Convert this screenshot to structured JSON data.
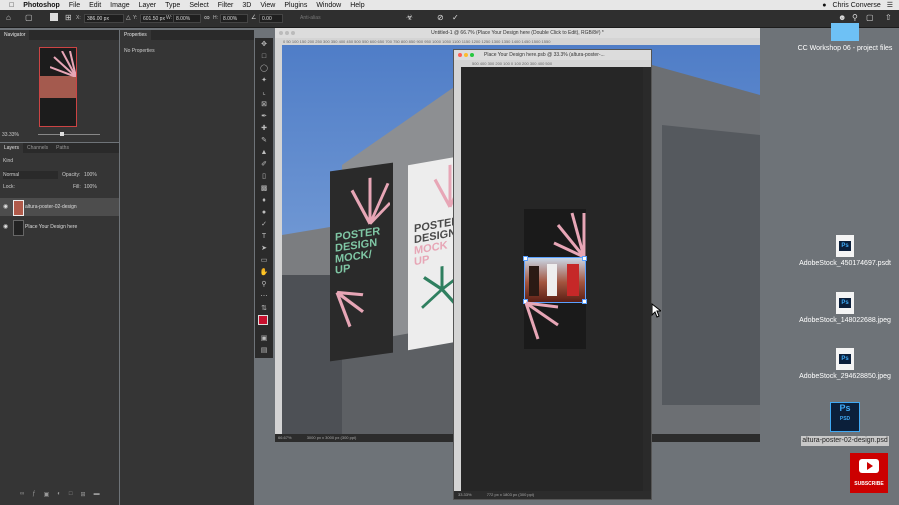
{
  "menubar": {
    "app": "Photoshop",
    "items": [
      "File",
      "Edit",
      "Image",
      "Layer",
      "Type",
      "Select",
      "Filter",
      "3D",
      "View",
      "Plugins",
      "Window",
      "Help"
    ],
    "user": "Chris Converse"
  },
  "options": {
    "x_label": "X:",
    "x_value": "386.00 px",
    "y_label": "Y:",
    "y_value": "601.50 px",
    "w_label": "W:",
    "w_value": "8.00%",
    "h_label": "H:",
    "h_value": "8.00%",
    "angle_value": "0.00",
    "interp": "Anti-alias"
  },
  "navigator": {
    "tab": "Navigator",
    "zoom": "33.33%"
  },
  "properties": {
    "tab": "Properties",
    "empty": "No Properties"
  },
  "layers": {
    "tabs": [
      "Layers",
      "Channels",
      "Paths"
    ],
    "kind": "Kind",
    "blend": "Normal",
    "opacity_label": "Opacity:",
    "opacity": "100%",
    "lock_label": "Lock:",
    "fill_label": "Fill:",
    "fill": "100%",
    "items": [
      {
        "name": "altura-poster-02-design"
      },
      {
        "name": "Place Your Design here"
      }
    ]
  },
  "doc1": {
    "title": "Untitled-1 @ 66.7% (Place Your Design here (Double Click to Edit), RGB/8#) *",
    "ruler": "0   50   100   150   200   250   300   350   400   450   500   550   600   650   700   750   800   850   900   950   1000   1050   1100   1150   1200   1250   1300   1350   1400   1450   1500   1550",
    "zoom": "66.67%",
    "size": "3000 px x 3000 px (300 ppi)",
    "poster_left": [
      "POSTER",
      "DESIGN",
      "MOCK/",
      "UP"
    ],
    "poster_right": [
      "POSTER",
      "DESIGN",
      "MOCK",
      "UP"
    ]
  },
  "doc2": {
    "title": "Place Your Design here.psb @ 33.3% (altura-poster-...",
    "ruler": "500    400    300    200    100    0    100    200    300    400    500",
    "zoom": "33.33%",
    "size": "772 px x 1803 px (300 ppi)"
  },
  "desktop": {
    "folder": "CC Workshop 06 - project files",
    "files": [
      {
        "name": "AdobeStock_450174697.psdt",
        "badge": "Ps"
      },
      {
        "name": "AdobeStock_148022688.jpeg",
        "badge": "Ps"
      },
      {
        "name": "AdobeStock_294628850.jpeg",
        "badge": "Ps"
      },
      {
        "name": "altura-poster-02-design.psd",
        "badge": "Ps"
      }
    ],
    "psd_label": "PSD",
    "subscribe": "SUBSCRIBE"
  },
  "colors": {
    "accent": "#31a8ff",
    "poster_pink": "#e7a6b6",
    "poster_green": "#2f7f5f"
  }
}
